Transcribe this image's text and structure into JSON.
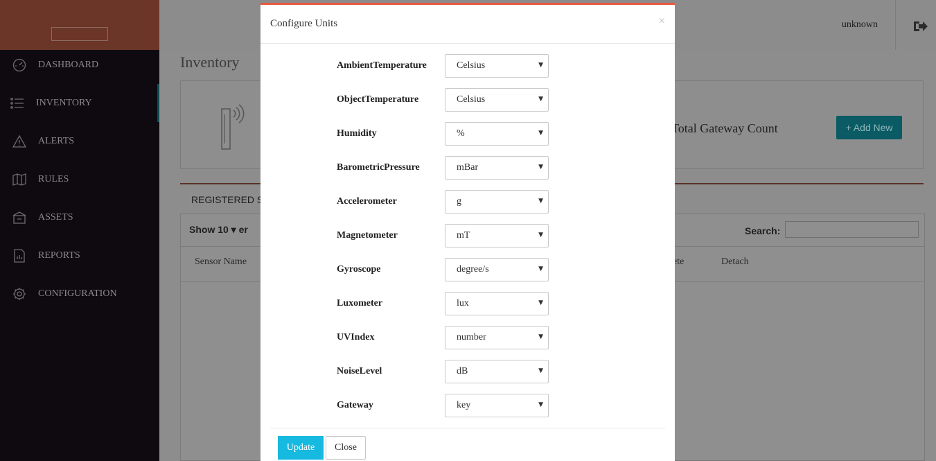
{
  "topbar": {
    "user": "unknown"
  },
  "sidebar": {
    "items": [
      {
        "label": "DASHBOARD",
        "icon": "dashboard-icon"
      },
      {
        "label": "INVENTORY",
        "icon": "list-icon"
      },
      {
        "label": "ALERTS",
        "icon": "alert-icon"
      },
      {
        "label": "RULES",
        "icon": "book-icon"
      },
      {
        "label": "ASSETS",
        "icon": "box-icon"
      },
      {
        "label": "REPORTS",
        "icon": "report-icon"
      },
      {
        "label": "CONFIGURATION",
        "icon": "gear-icon"
      }
    ]
  },
  "page": {
    "title": "Inventory",
    "count_value": ")",
    "count_label": "Total Gateway Count",
    "add_button": "+ Add New",
    "tab_label": "REGISTERED SE",
    "show_label": "Show  10   ▾  er",
    "search_label": "Search:",
    "columns": {
      "sensor_name": "Sensor Name",
      "delete": "ete",
      "detach": "Detach"
    }
  },
  "modal": {
    "title": "Configure Units",
    "close_glyph": "×",
    "fields": [
      {
        "label": "AmbientTemperature",
        "value": "Celsius"
      },
      {
        "label": "ObjectTemperature",
        "value": "Celsius"
      },
      {
        "label": "Humidity",
        "value": "%"
      },
      {
        "label": "BarometricPressure",
        "value": "mBar"
      },
      {
        "label": "Accelerometer",
        "value": "g"
      },
      {
        "label": "Magnetometer",
        "value": "mT"
      },
      {
        "label": "Gyroscope",
        "value": "degree/s"
      },
      {
        "label": "Luxometer",
        "value": "lux"
      },
      {
        "label": "UVIndex",
        "value": "number"
      },
      {
        "label": "NoiseLevel",
        "value": "dB"
      },
      {
        "label": "Gateway",
        "value": "key"
      }
    ],
    "update_button": "Update",
    "close_button": "Close"
  }
}
